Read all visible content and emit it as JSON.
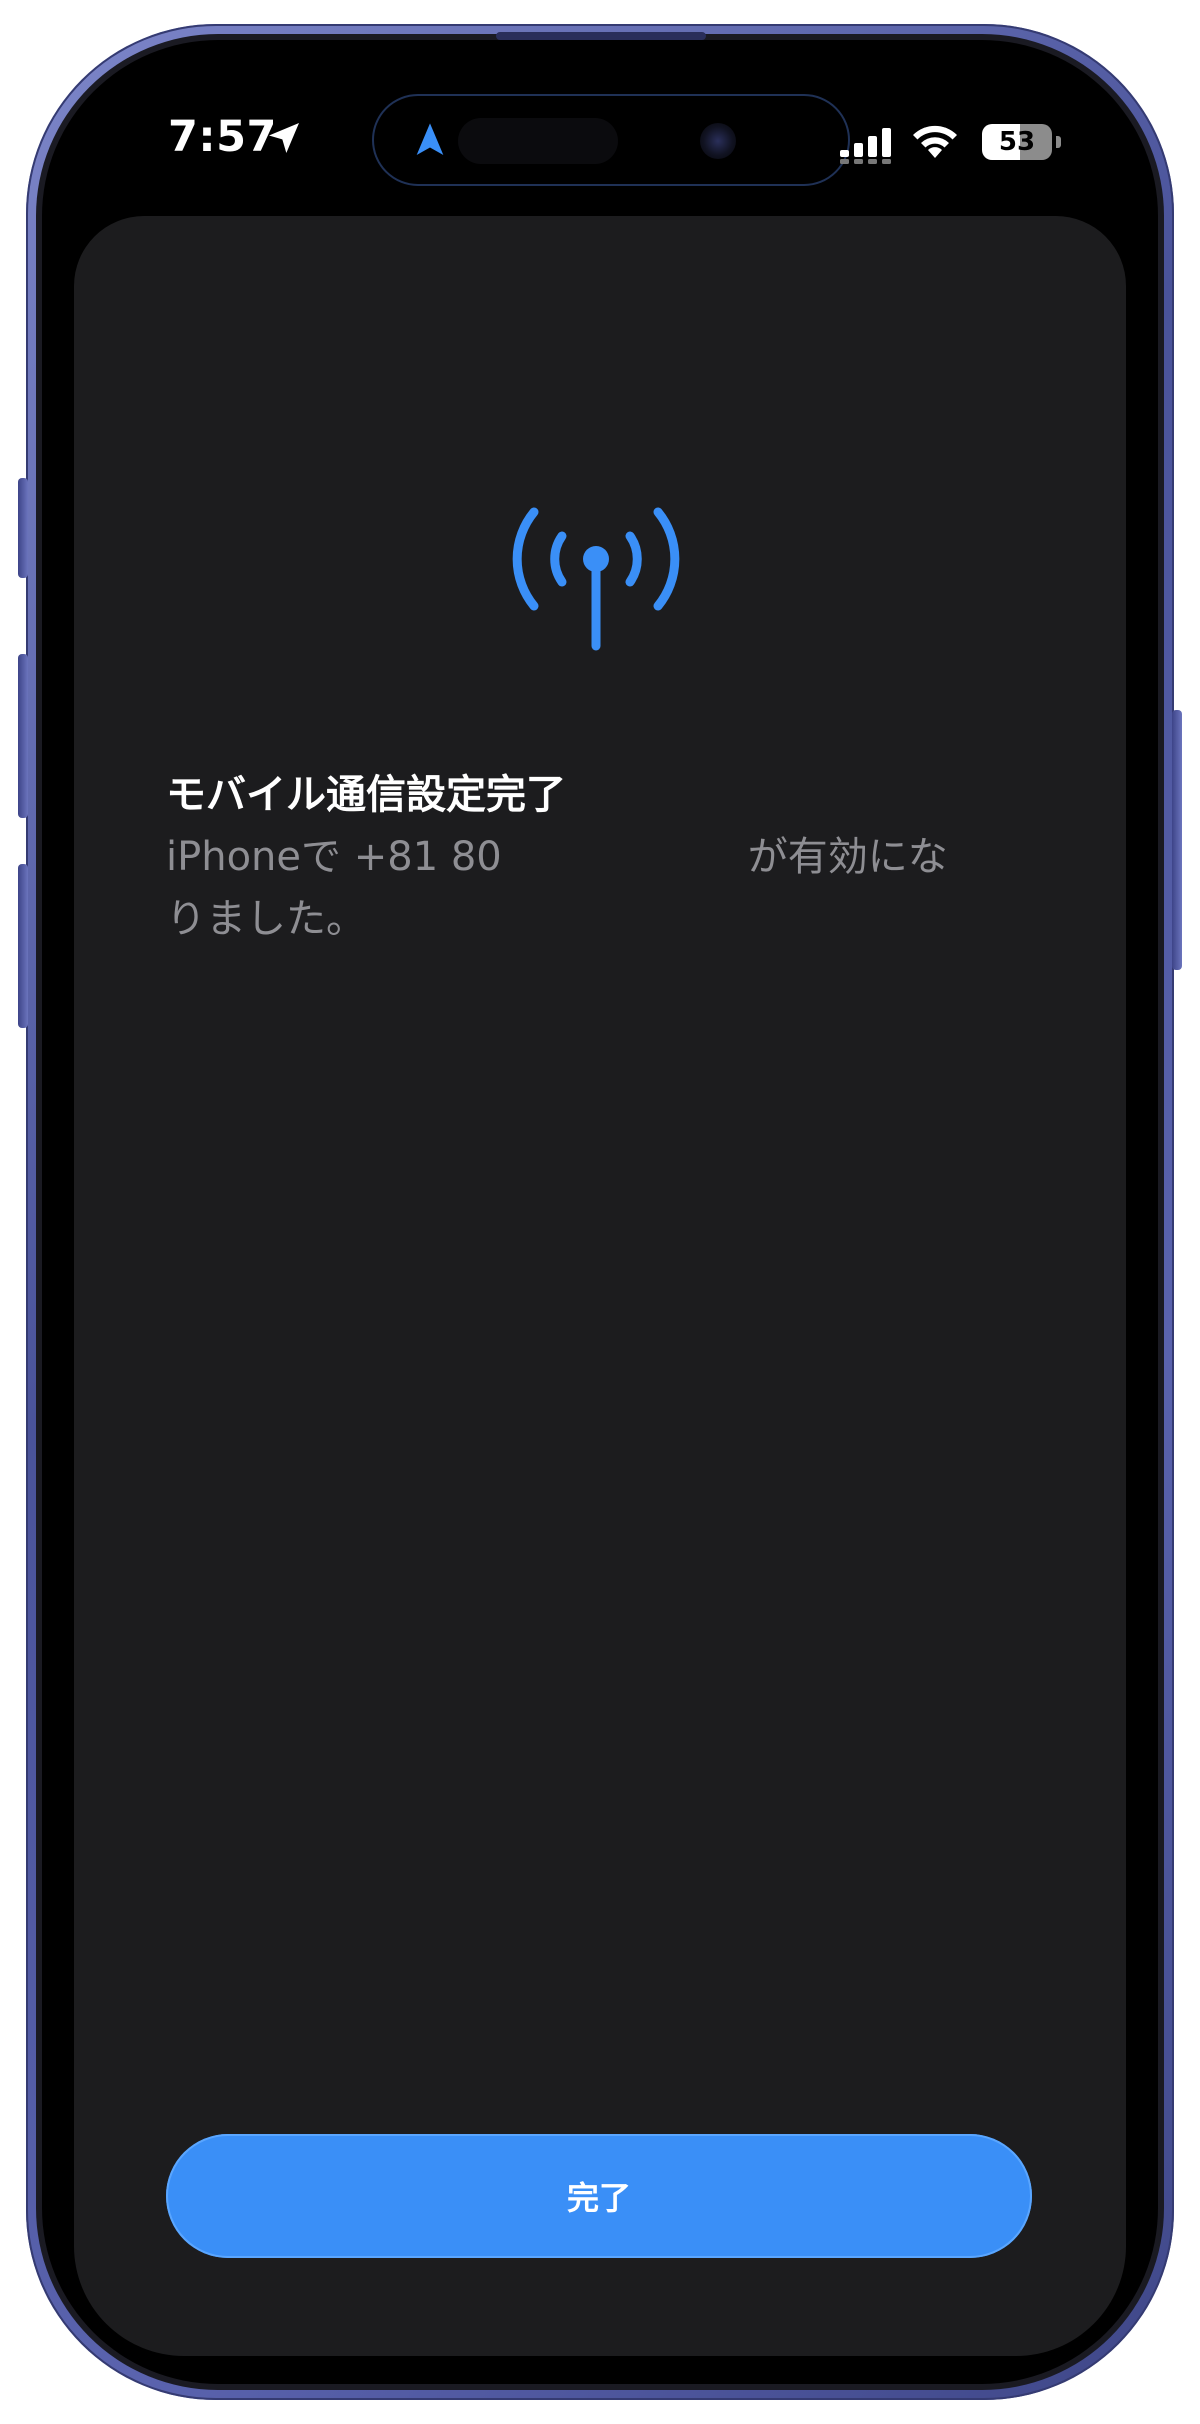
{
  "status_bar": {
    "time": "7:57",
    "battery": "53",
    "icons": [
      "location-arrow-icon",
      "navigation-icon",
      "cellular-signal-icon",
      "wifi-icon",
      "battery-icon"
    ]
  },
  "content": {
    "icon": "cellular-antenna-icon",
    "accent_color": "#3a8ff7",
    "title": "モバイル通信設定完了",
    "desc_prefix": "iPhoneで +81 80",
    "desc_suffix": "が有効にな",
    "desc_line2": "りました。"
  },
  "actions": {
    "done_label": "完了"
  }
}
